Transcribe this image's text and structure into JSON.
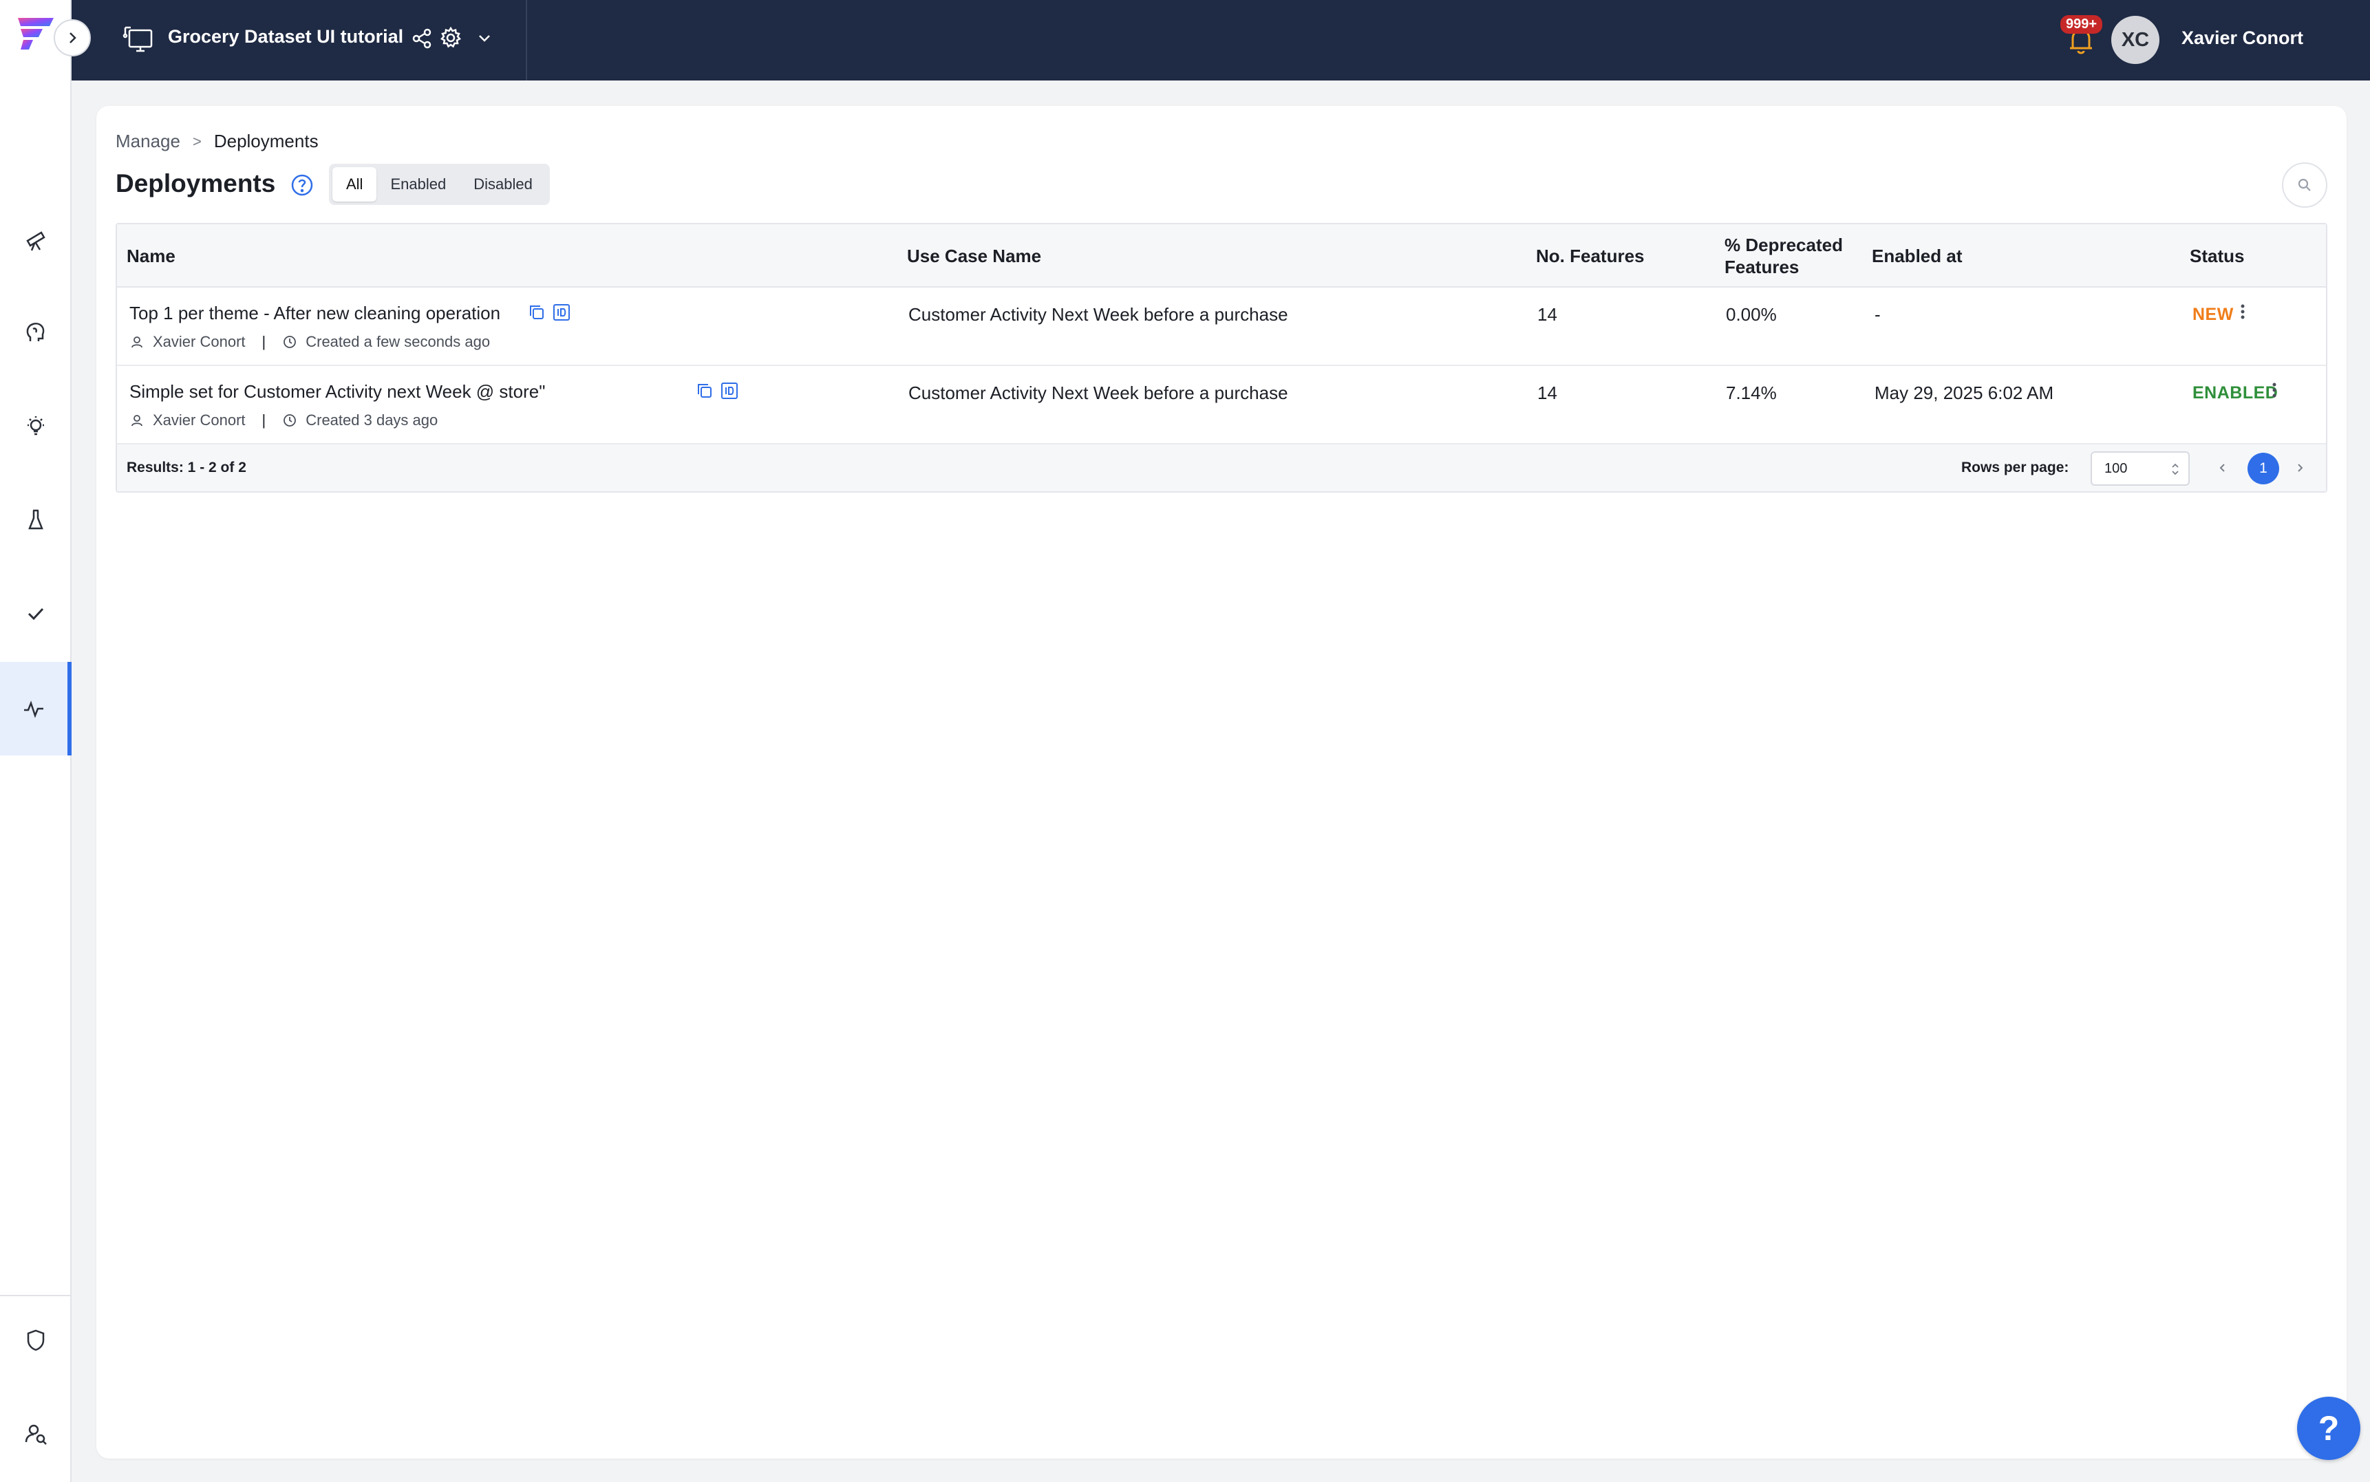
{
  "header": {
    "project_title": "Grocery Dataset UI tutorial",
    "notification_count": "999+",
    "user_initials": "XC",
    "user_name": "Xavier Conort"
  },
  "sidebar": {
    "items": [
      {
        "icon": "telescope-icon"
      },
      {
        "icon": "brain-icon"
      },
      {
        "icon": "lightbulb-icon"
      },
      {
        "icon": "flask-icon"
      },
      {
        "icon": "check-icon"
      },
      {
        "icon": "activity-icon",
        "active": true
      },
      {
        "icon": "shield-icon"
      },
      {
        "icon": "user-search-icon"
      }
    ]
  },
  "breadcrumb": {
    "root": "Manage",
    "separator": ">",
    "current": "Deployments"
  },
  "page": {
    "title": "Deployments"
  },
  "filters": {
    "all": "All",
    "enabled": "Enabled",
    "disabled": "Disabled",
    "selected": "All"
  },
  "table": {
    "headers": {
      "name": "Name",
      "use_case": "Use Case Name",
      "features": "No. Features",
      "deprecated_1": "% Deprecated",
      "deprecated_2": "Features",
      "enabled_at": "Enabled at",
      "status": "Status"
    },
    "rows": [
      {
        "name": "Top 1 per theme - After new cleaning operation",
        "owner": "Xavier Conort",
        "created": "Created a few seconds ago",
        "use_case": "Customer Activity Next Week before a purchase",
        "features": "14",
        "deprecated": "0.00%",
        "enabled_at": "-",
        "status": "NEW"
      },
      {
        "name": "Simple set for Customer Activity next Week @ store\"",
        "owner": "Xavier Conort",
        "created": "Created 3 days ago",
        "use_case": "Customer Activity Next Week before a purchase",
        "features": "14",
        "deprecated": "7.14%",
        "enabled_at": "May 29, 2025 6:02 AM",
        "status": "ENABLED"
      }
    ],
    "footer": {
      "results": "Results: 1 - 2 of 2",
      "rows_per_page_label": "Rows per page:",
      "rows_per_page_value": "100",
      "current_page": "1"
    }
  },
  "help_fab": "?",
  "colors": {
    "topbar": "#1f2a44",
    "accent": "#2f6ee8",
    "status_new": "#f07d1a",
    "status_enabled": "#2f8f3a"
  }
}
